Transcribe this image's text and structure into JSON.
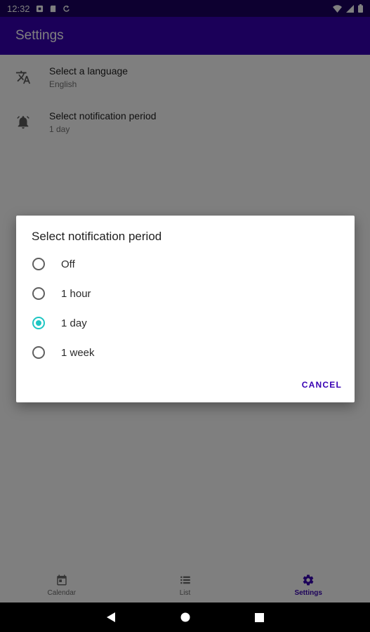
{
  "status_bar": {
    "time": "12:32",
    "icons": [
      "notification-icon",
      "sd-card-icon",
      "sync-icon",
      "wifi-icon",
      "signal-icon",
      "battery-icon"
    ]
  },
  "app_bar": {
    "title": "Settings"
  },
  "settings": [
    {
      "icon": "translate-icon",
      "title": "Select a language",
      "value": "English"
    },
    {
      "icon": "alarm-bell-icon",
      "title": "Select notification period",
      "value": "1 day"
    }
  ],
  "bottom_nav": [
    {
      "icon": "calendar-icon",
      "label": "Calendar",
      "active": false
    },
    {
      "icon": "list-icon",
      "label": "List",
      "active": false
    },
    {
      "icon": "gear-icon",
      "label": "Settings",
      "active": true
    }
  ],
  "dialog": {
    "title": "Select notification period",
    "options": [
      {
        "label": "Off",
        "checked": false
      },
      {
        "label": "1 hour",
        "checked": false
      },
      {
        "label": "1 day",
        "checked": true
      },
      {
        "label": "1 week",
        "checked": false
      }
    ],
    "cancel_label": "CANCEL"
  },
  "colors": {
    "primary": "#3700b3",
    "status_bar": "#1a0060",
    "accent": "#1ec6c3"
  }
}
